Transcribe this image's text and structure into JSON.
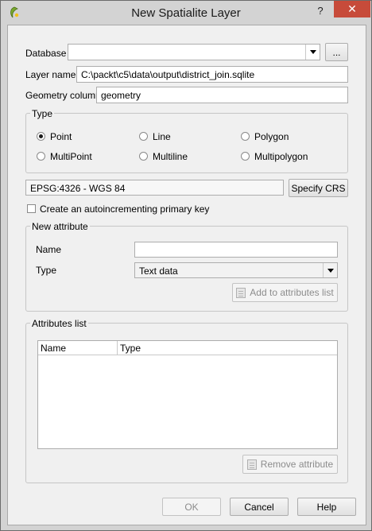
{
  "window": {
    "title": "New Spatialite Layer",
    "help_glyph": "?",
    "close_glyph": "✕"
  },
  "database": {
    "label": "Database",
    "value": "",
    "browse_label": "..."
  },
  "layer_name": {
    "label": "Layer name",
    "value": "C:\\packt\\c5\\data\\output\\district_join.sqlite"
  },
  "geometry_column": {
    "label": "Geometry column",
    "value": "geometry"
  },
  "type_group": {
    "title": "Type",
    "options": [
      {
        "label": "Point",
        "checked": true
      },
      {
        "label": "Line",
        "checked": false
      },
      {
        "label": "Polygon",
        "checked": false
      },
      {
        "label": "MultiPoint",
        "checked": false
      },
      {
        "label": "Multiline",
        "checked": false
      },
      {
        "label": "Multipolygon",
        "checked": false
      }
    ]
  },
  "crs": {
    "value": "EPSG:4326 - WGS 84",
    "specify_label": "Specify CRS"
  },
  "primary_key": {
    "label": "Create an autoincrementing primary key",
    "checked": false
  },
  "new_attribute": {
    "title": "New attribute",
    "name_label": "Name",
    "name_value": "",
    "type_label": "Type",
    "type_value": "Text data",
    "add_label": "Add to attributes list"
  },
  "attributes_list": {
    "title": "Attributes list",
    "columns": [
      "Name",
      "Type"
    ],
    "remove_label": "Remove attribute"
  },
  "buttons": {
    "ok": "OK",
    "cancel": "Cancel",
    "help": "Help"
  },
  "colors": {
    "close_button": "#c74b3a",
    "dialog_background": "#f0f0f0",
    "titlebar": "#d3d3d3"
  }
}
